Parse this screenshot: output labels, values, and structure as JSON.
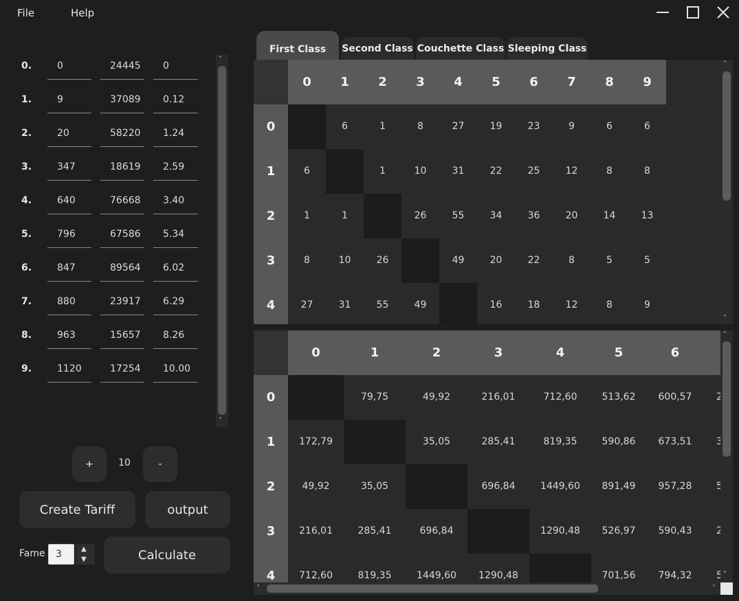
{
  "menu": {
    "file": "File",
    "help": "Help"
  },
  "window_controls": [
    "minimize-icon",
    "maximize-icon",
    "close-icon"
  ],
  "stops": [
    {
      "index": "0.",
      "a": "0",
      "b": "24445",
      "c": "0"
    },
    {
      "index": "1.",
      "a": "9",
      "b": "37089",
      "c": "0.12"
    },
    {
      "index": "2.",
      "a": "20",
      "b": "58220",
      "c": "1.24"
    },
    {
      "index": "3.",
      "a": "347",
      "b": "18619",
      "c": "2.59"
    },
    {
      "index": "4.",
      "a": "640",
      "b": "76668",
      "c": "3.40"
    },
    {
      "index": "5.",
      "a": "796",
      "b": "67586",
      "c": "5.34"
    },
    {
      "index": "6.",
      "a": "847",
      "b": "89564",
      "c": "6.02"
    },
    {
      "index": "7.",
      "a": "880",
      "b": "23917",
      "c": "6.29"
    },
    {
      "index": "8.",
      "a": "963",
      "b": "15657",
      "c": "8.26"
    },
    {
      "index": "9.",
      "a": "1120",
      "b": "17254",
      "c": "10.00"
    }
  ],
  "counter": {
    "plus": "+",
    "value": "10",
    "minus": "-"
  },
  "buttons": {
    "create_tariff": "Create Tariff",
    "output": "output",
    "calculate": "Calculate"
  },
  "fame": {
    "label": "Fame",
    "value": "3"
  },
  "tabs": [
    "First Class",
    "Second Class",
    "Couchette Class",
    "Sleeping Class"
  ],
  "top_table": {
    "columns": [
      "0",
      "1",
      "2",
      "3",
      "4",
      "5",
      "6",
      "7",
      "8",
      "9"
    ],
    "rows": [
      "0",
      "1",
      "2",
      "3",
      "4"
    ],
    "cells": [
      [
        "",
        "6",
        "1",
        "8",
        "27",
        "19",
        "23",
        "9",
        "6",
        "6"
      ],
      [
        "6",
        "",
        "1",
        "10",
        "31",
        "22",
        "25",
        "12",
        "8",
        "8"
      ],
      [
        "1",
        "1",
        "",
        "26",
        "55",
        "34",
        "36",
        "20",
        "14",
        "13"
      ],
      [
        "8",
        "10",
        "26",
        "",
        "49",
        "20",
        "22",
        "8",
        "5",
        "5"
      ],
      [
        "27",
        "31",
        "55",
        "49",
        "",
        "16",
        "18",
        "12",
        "8",
        "9"
      ]
    ]
  },
  "bottom_table": {
    "columns": [
      "0",
      "1",
      "2",
      "3",
      "4",
      "5",
      "6"
    ],
    "rows": [
      "0",
      "1",
      "2",
      "3",
      "4"
    ],
    "cells": [
      [
        "",
        "79,75",
        "49,92",
        "216,01",
        "712,60",
        "513,62",
        "600,57",
        "2"
      ],
      [
        "172,79",
        "",
        "35,05",
        "285,41",
        "819,35",
        "590,86",
        "673,51",
        "3"
      ],
      [
        "49,92",
        "35,05",
        "",
        "696,84",
        "1449,60",
        "891,49",
        "957,28",
        "5"
      ],
      [
        "216,01",
        "285,41",
        "696,84",
        "",
        "1290,48",
        "526,97",
        "590,43",
        "2"
      ],
      [
        "712,60",
        "819,35",
        "1449,60",
        "1290,48",
        "",
        "701,56",
        "794,32",
        "5"
      ]
    ]
  }
}
